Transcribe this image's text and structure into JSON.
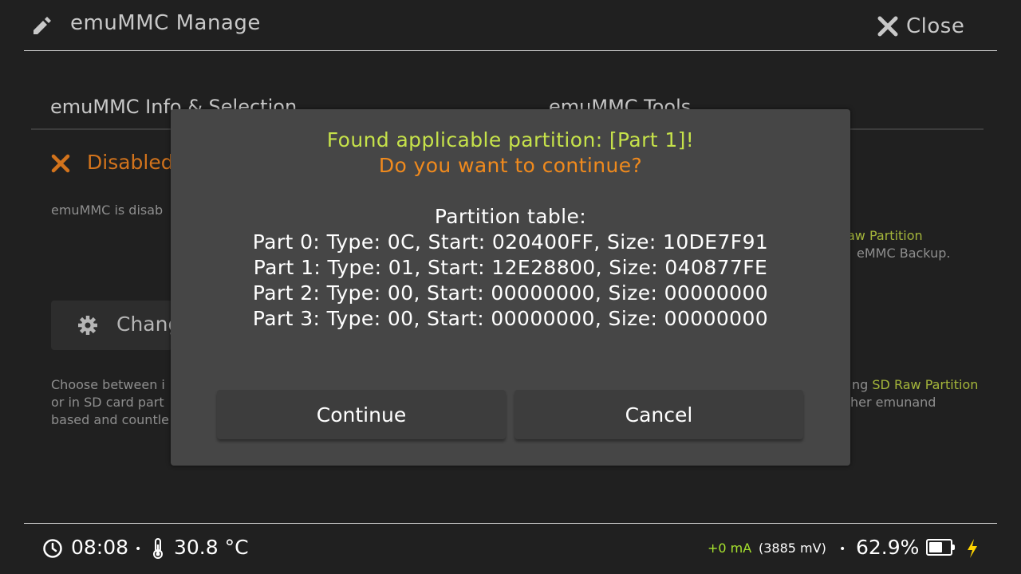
{
  "header": {
    "title": "emuMMC Manage",
    "close_label": "Close"
  },
  "panel_left": {
    "title": "emuMMC Info & Selection",
    "status": "Disabled",
    "status_desc": "emuMMC is disab",
    "change_button": "Chang",
    "desc_lines": [
      "Choose between i",
      "or in SD card part",
      "based and countle"
    ]
  },
  "panel_right": {
    "title": "emuMMC Tools",
    "line1_hl": "aw Partition",
    "line2": "eMMC Backup.",
    "line3_prefix": "ng",
    "line3_hl": "SD Raw Partition",
    "line4": "her emunand"
  },
  "dialog": {
    "found_line": "Found applicable partition: [Part 1]!",
    "question_line": "Do you want to continue?",
    "table_title": "Partition table:",
    "parts": [
      "Part 0: Type: 0C, Start: 020400FF, Size: 10DE7F91",
      "Part 1: Type: 01, Start: 12E28800, Size: 040877FE",
      "Part 2: Type: 00, Start: 00000000, Size: 00000000",
      "Part 3: Type: 00, Start: 00000000, Size: 00000000"
    ],
    "continue_label": "Continue",
    "cancel_label": "Cancel"
  },
  "footer": {
    "time": "08:08",
    "temperature": "30.8 °C",
    "current": "+0 mA",
    "voltage": "(3885 mV)",
    "battery_percent": "62.9%",
    "battery_level": 0.629
  },
  "colors": {
    "accent_green": "#c6e24a",
    "accent_orange": "#f08a1d",
    "status_orange": "#d2731c",
    "highlight": "#a4b53a"
  }
}
